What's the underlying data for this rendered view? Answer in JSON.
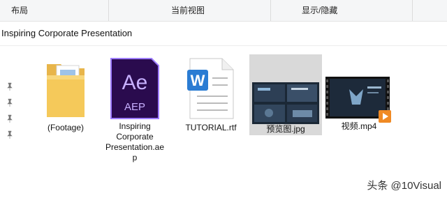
{
  "ribbon": {
    "layout": "布局",
    "current_view": "当前视图",
    "show_hide": "显示/隐藏"
  },
  "path": {
    "folder": "Inspiring Corporate Presentation"
  },
  "files": [
    {
      "name": "(Footage)",
      "icon": "folder-icon"
    },
    {
      "name": "Inspiring Corporate Presentation.aep",
      "icon": "after-effects-icon",
      "badge_top": "Ae",
      "badge_bottom": "AEP",
      "lines": [
        "Inspiring",
        "Corporate",
        "Presentation.ae",
        "p"
      ]
    },
    {
      "name": "TUTORIAL.rtf",
      "icon": "word-document-icon",
      "badge": "W"
    },
    {
      "name": "预览图.jpg",
      "icon": "image-thumbnail",
      "selected": true
    },
    {
      "name": "视频.mp4",
      "icon": "video-thumbnail"
    }
  ],
  "watermark": {
    "text": "头条 @10Visual"
  },
  "colors": {
    "ae_purple": "#2a0b4e",
    "ae_accent": "#9d7cff",
    "folder": "#f5c95a",
    "word_blue": "#2b7cd3"
  }
}
